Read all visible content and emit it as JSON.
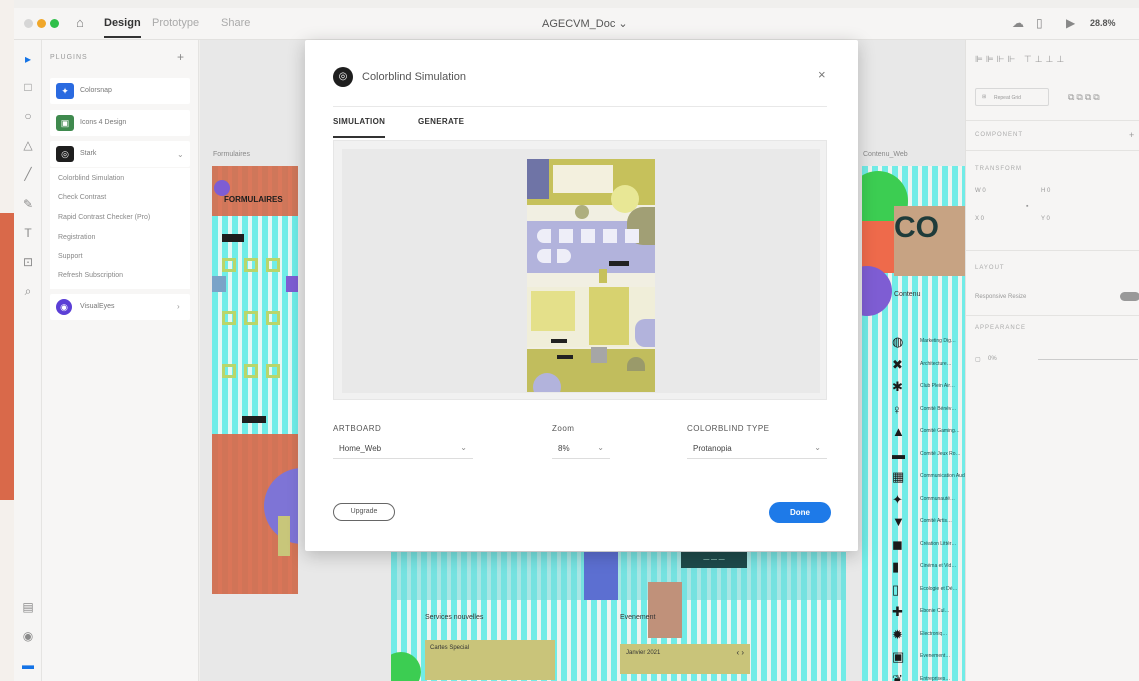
{
  "titlebar": {
    "tabs": [
      {
        "label": "Design",
        "active": true
      },
      {
        "label": "Prototype",
        "active": false
      },
      {
        "label": "Share",
        "active": false
      }
    ],
    "document_title": "AGECVM_Doc ⌄",
    "zoom": "28.8%"
  },
  "plugins_panel": {
    "title": "PLUGINS",
    "add": "+",
    "installed": [
      {
        "name": "Colorsnap",
        "color": "#2a6ae0"
      },
      {
        "name": "Icons 4 Design",
        "color": "#3f8a4e"
      },
      {
        "name": "Stark",
        "color": "#1e1e1e"
      }
    ],
    "stark_commands": [
      "Colorblind Simulation",
      "Check Contrast",
      "Rapid Contrast Checker (Pro)",
      "Registration",
      "Support",
      "Refresh Subscription"
    ],
    "other": {
      "name": "VisualEyes",
      "color": "#5b3fd6"
    }
  },
  "canvas": {
    "artboard_left_label": "Formulaires",
    "artboard_left_heading": "FORMULAIRES",
    "artboard_right_label": "Contenu_Web",
    "artboard_right_heading": "CO",
    "artboard_right_sub": "Contenu",
    "artboard_bottom": {
      "button": "— — —",
      "col1": "Services nouvelles",
      "col2": "Evenement",
      "card": "Cartes Special",
      "date_card": "Janvier 2021",
      "nav": "‹ ›"
    },
    "list_items": [
      "Marketing Dig…",
      "Architecture…",
      "Club Plein Air…",
      "Comité Bénév…",
      "Comité Gaming…",
      "Comité Jeux Ro…",
      "Communication Audiovisuelle",
      "Communauté…",
      "Comité Artis…",
      "Création Littér…",
      "Cinéma et Vid…",
      "Ecologie et Dé…",
      "Ebonie Cul…",
      "Electroniq…",
      "Evenement…",
      "Entreprises…"
    ]
  },
  "properties_panel": {
    "repeat_grid": "Repeat Grid",
    "component": "COMPONENT",
    "transform": "TRANSFORM",
    "w": "W 0",
    "h": "H 0",
    "x": "X 0",
    "y": "Y 0",
    "layout": "LAYOUT",
    "responsive_resize": "Responsive Resize",
    "appearance": "APPEARANCE",
    "opacity": "0%"
  },
  "modal": {
    "title": "Colorblind Simulation",
    "close": "×",
    "tabs": [
      {
        "label": "SIMULATION",
        "active": true
      },
      {
        "label": "GENERATE",
        "active": false
      }
    ],
    "fields": {
      "artboard": {
        "label": "ARTBOARD",
        "value": "Home_Web"
      },
      "zoom": {
        "label": "Zoom",
        "value": "8%"
      },
      "colorblind_type": {
        "label": "COLORBLIND TYPE",
        "value": "Protanopia"
      }
    },
    "upgrade_label": "Upgrade",
    "done_label": "Done"
  },
  "colors": {
    "accent": "#1e7ae8",
    "aqua": "#5cecea",
    "salmon": "#d9694a",
    "olive_sim": "#c1bd5d",
    "lavender_sim": "#b2b3dc"
  }
}
